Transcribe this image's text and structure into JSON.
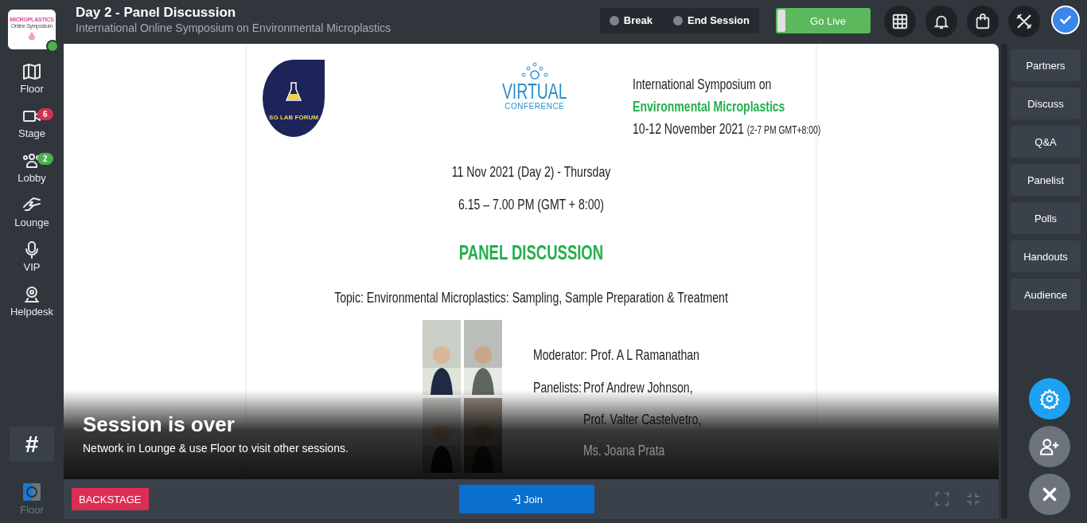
{
  "header": {
    "logo": {
      "title": "MICROPLASTICS",
      "subtitle": "Online Symposium",
      "online": true
    },
    "title": "Day 2 - Panel Discussion",
    "subtitle": "International Online Symposium on Environmental Microplastics"
  },
  "session_controls": [
    {
      "label": "Break",
      "selected": false
    },
    {
      "label": "End Session",
      "selected": false
    }
  ],
  "go_live": {
    "label": "Go Live"
  },
  "nav": [
    {
      "label": "Floor",
      "kind": "map"
    },
    {
      "label": "Stage",
      "kind": "video",
      "badge": "6",
      "color": "#d6304f"
    },
    {
      "label": "Lobby",
      "kind": "users",
      "badge": "2",
      "color": "#4caf50"
    },
    {
      "label": "Lounge",
      "kind": "handshake"
    },
    {
      "label": "VIP",
      "kind": "mic"
    },
    {
      "label": "Helpdesk",
      "kind": "webcam"
    }
  ],
  "channel_button": "#",
  "floor_shortcut": {
    "label": "Floor"
  },
  "slide": {
    "forum_logo": "SG LAB FORUM",
    "virtual_logo": {
      "title": "VIRTUAL",
      "subtitle": "CONFERENCE"
    },
    "event": {
      "line1": "International Symposium on",
      "line2": "Environmental Microplastics",
      "dates": "10-12 November 2021",
      "hours": "(2-7 PM GMT+8:00)"
    },
    "date": "11 Nov 2021 (Day 2) - Thursday",
    "time": "6.15 – 7.00 PM (GMT + 8:00)",
    "heading": "PANEL DISCUSSION",
    "topic": "Topic: Environmental Microplastics: Sampling, Sample Preparation & Treatment",
    "photos": [
      {
        "kind": "picture"
      },
      {
        "kind": "picture"
      },
      {
        "kind": "picture"
      },
      {
        "kind": "picture"
      }
    ],
    "moderator": "Moderator: Prof. A L Ramanathan",
    "panelists_label": "Panelists:",
    "panelists": [
      "Prof Andrew Johnson,",
      "Prof. Valter Castelvetro,",
      "Ms. Joana Prata"
    ]
  },
  "overlay": {
    "title": "Session is over",
    "message": "Network in Lounge & use Floor to visit other sessions."
  },
  "backstage": "BACKSTAGE",
  "join": "Join",
  "side_tabs": [
    "Partners",
    "Discuss",
    "Q&A",
    "Panelist",
    "Polls",
    "Handouts",
    "Audience"
  ]
}
